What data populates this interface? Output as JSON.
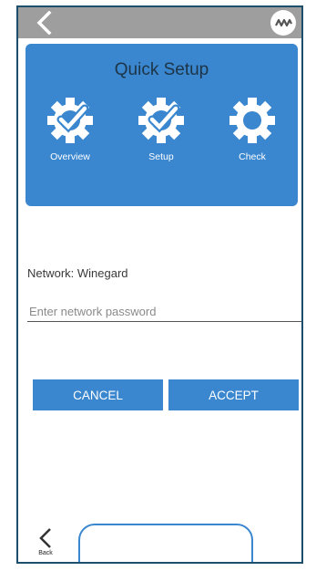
{
  "header": {
    "back_icon": "chevron-left-icon",
    "logo_icon": "winegard-logo-icon"
  },
  "setup_card": {
    "title": "Quick Setup",
    "steps": [
      {
        "label": "Overview",
        "icon": "gear-check-icon",
        "status": "complete"
      },
      {
        "label": "Setup",
        "icon": "gear-check-icon",
        "status": "complete"
      },
      {
        "label": "Check",
        "icon": "gear-icon",
        "status": "pending"
      }
    ]
  },
  "network": {
    "label": "Network: Winegard",
    "password_placeholder": "Enter network password",
    "password_value": ""
  },
  "actions": {
    "cancel_label": "CANCEL",
    "accept_label": "ACCEPT"
  },
  "footer": {
    "back_label": "Back"
  },
  "colors": {
    "accent": "#3a87cf",
    "topbar": "#9e9e9e",
    "frame": "#1b4f6b"
  }
}
